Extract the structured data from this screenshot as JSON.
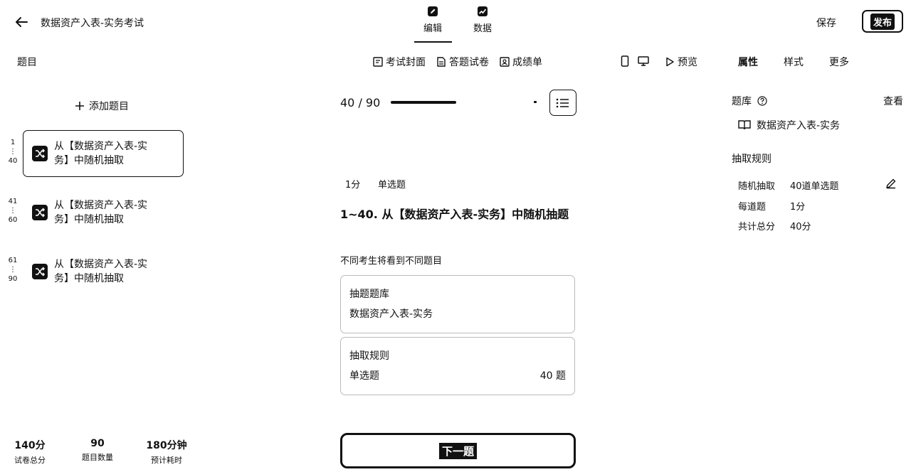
{
  "header": {
    "title": "数据资产入表-实务考试",
    "tabs": [
      {
        "label": "编辑",
        "icon": "pencil-icon"
      },
      {
        "label": "数据",
        "icon": "chart-icon"
      }
    ],
    "save_label": "保存",
    "publish_label": "发布"
  },
  "toolbar": {
    "left_title": "题目",
    "center_tabs": [
      {
        "label": "考试封面",
        "icon": "cover-icon"
      },
      {
        "label": "答题试卷",
        "icon": "paper-icon"
      },
      {
        "label": "成绩单",
        "icon": "report-icon"
      }
    ],
    "preview_label": "预览",
    "right_tabs": [
      "属性",
      "样式",
      "更多"
    ]
  },
  "sidebar": {
    "add_label": "添加题目",
    "items": [
      {
        "range_start": "1",
        "range_end": "40",
        "label": "从【数据资产入表-实务】中随机抽取"
      },
      {
        "range_start": "41",
        "range_end": "60",
        "label": "从【数据资产入表-实务】中随机抽取"
      },
      {
        "range_start": "61",
        "range_end": "90",
        "label": "从【数据资产入表-实务】中随机抽取"
      }
    ],
    "stats": [
      {
        "value": "140分",
        "label": "试卷总分"
      },
      {
        "value": "90",
        "label": "题目数量"
      },
      {
        "value": "180分钟",
        "label": "预计耗时"
      }
    ]
  },
  "main": {
    "progress_text": "40 / 90",
    "progress": {
      "current": 40,
      "total": 90
    },
    "score_tag": "1分",
    "type_tag": "单选题",
    "question_title": "1~40. 从【数据资产入表-实务】中随机抽题",
    "note": "不同考生将看到不同题目",
    "bank_card": {
      "title": "抽题题库",
      "value": "数据资产入表-实务"
    },
    "rule_card": {
      "title": "抽取规则",
      "type": "单选题",
      "count": "40 题"
    },
    "next_label": "下一题"
  },
  "props": {
    "bank_label": "题库",
    "view_label": "查看",
    "bank_name": "数据资产入表-实务",
    "rule_label": "抽取规则",
    "rules": [
      {
        "key": "随机抽取",
        "value": "40道单选题"
      },
      {
        "key": "每道题",
        "value": "1分"
      },
      {
        "key": "共计总分",
        "value": "40分"
      }
    ]
  }
}
